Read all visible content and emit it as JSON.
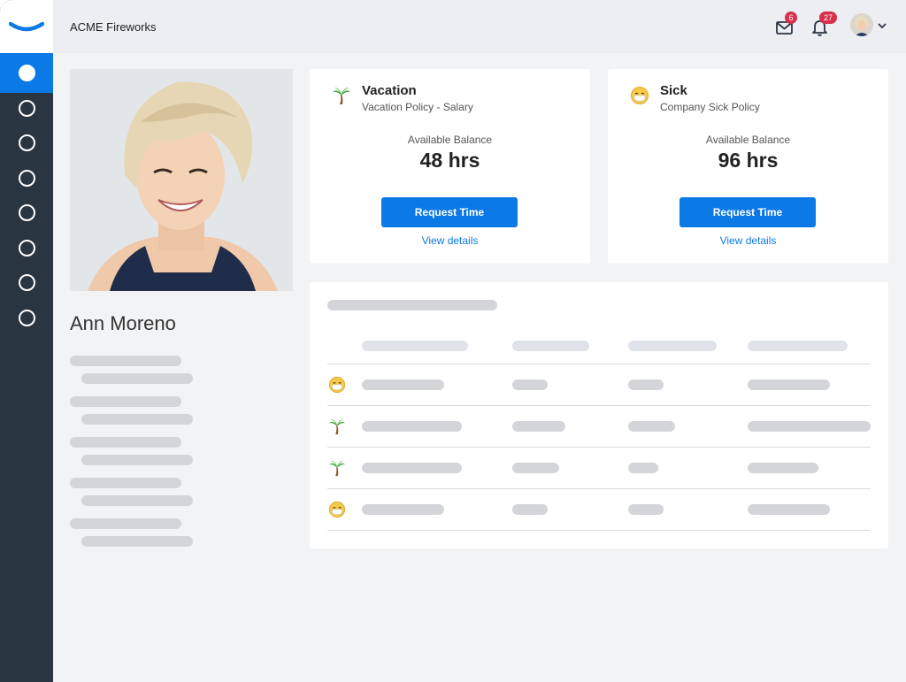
{
  "topbar": {
    "company": "ACME Fireworks",
    "mail_icon": "mail-icon",
    "mail_count": "6",
    "bell_icon": "bell-icon",
    "notification_count": "27",
    "avatar_icon": "user-avatar",
    "menu_icon": "chevron-down-icon"
  },
  "sidebar": {
    "logo_icon": "smile-logo-icon",
    "items": [
      {
        "icon": "circle-icon",
        "active": true
      },
      {
        "icon": "circle-icon",
        "active": false
      },
      {
        "icon": "circle-icon",
        "active": false
      },
      {
        "icon": "circle-icon",
        "active": false
      },
      {
        "icon": "circle-icon",
        "active": false
      },
      {
        "icon": "circle-icon",
        "active": false
      },
      {
        "icon": "circle-icon",
        "active": false
      },
      {
        "icon": "circle-icon",
        "active": false
      }
    ]
  },
  "profile": {
    "name": "Ann Moreno"
  },
  "policies": [
    {
      "icon": "palm-tree-icon",
      "title": "Vacation",
      "subtitle": "Vacation Policy - Salary",
      "balance_label": "Available Balance",
      "balance": "48 hrs",
      "button": "Request Time",
      "link": "View details"
    },
    {
      "icon": "sick-face-icon",
      "title": "Sick",
      "subtitle": "Company Sick Policy",
      "balance_label": "Available Balance",
      "balance": "96 hrs",
      "button": "Request Time",
      "link": "View details"
    }
  ],
  "history": {
    "rows": [
      {
        "icon": "sick-face-icon"
      },
      {
        "icon": "palm-tree-icon"
      },
      {
        "icon": "palm-tree-icon"
      },
      {
        "icon": "sick-face-icon"
      }
    ]
  },
  "colors": {
    "sidebar_bg": "#2a3542",
    "accent": "#0c7ae6",
    "badge": "#d6304a",
    "page_bg": "#f2f3f5"
  }
}
